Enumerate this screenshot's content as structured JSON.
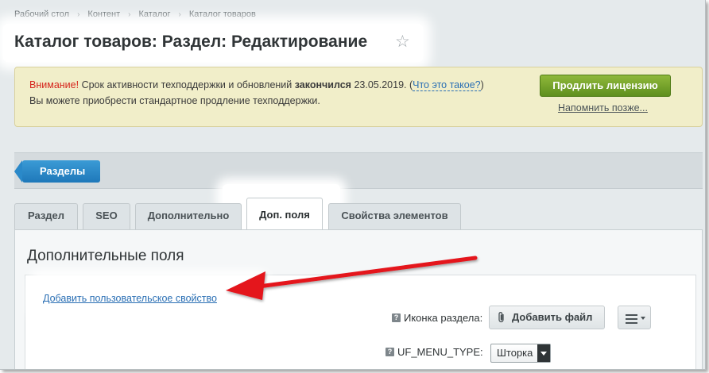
{
  "breadcrumb": [
    "Рабочий стол",
    "Контент",
    "Каталог",
    "Каталог товаров"
  ],
  "page_title": "Каталог товаров: Раздел: Редактирование",
  "alert": {
    "warning_label": "Внимание!",
    "text_part1": " Срок активности техподдержки и обновлений ",
    "ended_label": "закончился",
    "date": " 23.05.2019. ",
    "paren_open": "(",
    "what_link": "Что это такое?",
    "paren_close": ")",
    "line2": "Вы можете приобрести стандартное продление техподдержки.",
    "renew_button": "Продлить лицензию",
    "remind_link": "Напомнить позже..."
  },
  "sections_button": "Разделы",
  "tabs": [
    {
      "label": "Раздел"
    },
    {
      "label": "SEO"
    },
    {
      "label": "Дополнительно"
    },
    {
      "label": "Доп. поля"
    },
    {
      "label": "Свойства элементов"
    }
  ],
  "panel": {
    "title": "Дополнительные поля",
    "add_link": "Добавить пользовательское свойство",
    "fields": {
      "icon_label": "Иконка раздела:",
      "file_button": "Добавить файл",
      "menu_type_label": "UF_MENU_TYPE:",
      "menu_type_value": "Шторка"
    },
    "help_glyph": "?"
  },
  "colors": {
    "arrow": "#e4121c",
    "renew_green": "#6fa128",
    "sections_blue": "#2585c7"
  }
}
